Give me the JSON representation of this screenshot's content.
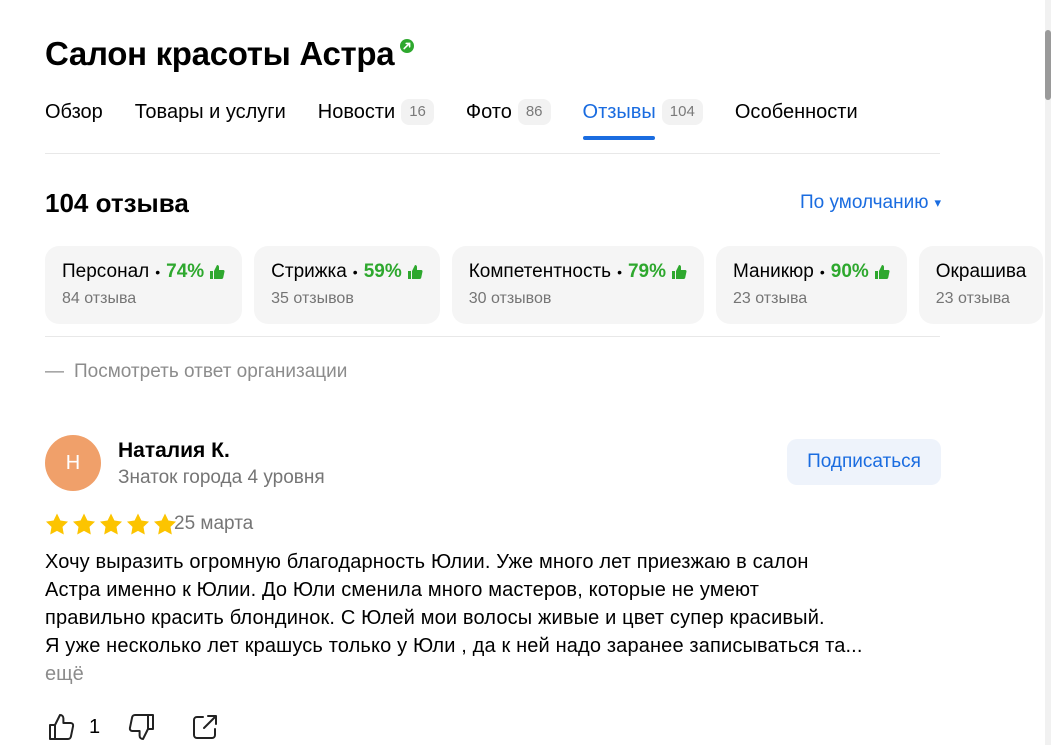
{
  "header": {
    "title": "Салон красоты Астра"
  },
  "tabs": [
    {
      "label": "Обзор",
      "badge": ""
    },
    {
      "label": "Товары и услуги",
      "badge": ""
    },
    {
      "label": "Новости",
      "badge": "16"
    },
    {
      "label": "Фото",
      "badge": "86"
    },
    {
      "label": "Отзывы",
      "badge": "104",
      "active": true
    },
    {
      "label": "Особенности",
      "badge": ""
    }
  ],
  "reviews": {
    "count_label": "104 отзыва",
    "sort_label": "По умолчанию",
    "sort_arrow": "▾"
  },
  "aspects": [
    {
      "name": "Персонал",
      "percent": "74%",
      "count": "84 отзыва"
    },
    {
      "name": "Стрижка",
      "percent": "59%",
      "count": "35 отзывов"
    },
    {
      "name": "Компетентность",
      "percent": "79%",
      "count": "30 отзывов"
    },
    {
      "name": "Маникюр",
      "percent": "90%",
      "count": "23 отзыва"
    },
    {
      "name": "Окрашива",
      "percent": "",
      "count": "23 отзыва"
    }
  ],
  "aspect_dot": "•",
  "org_reply": {
    "dash": "—",
    "label": "Посмотреть ответ организации"
  },
  "review": {
    "avatar_letter": "Н",
    "author": "Наталия К.",
    "level": "Знаток города 4 уровня",
    "subscribe_label": "Подписаться",
    "rating": 5,
    "date": "25 марта",
    "text_lines": [
      "Хочу выразить огромную благодарность Юлии. Уже много лет приезжаю в салон",
      "Астра именно к Юлии. До Юли сменила много мастеров, которые не умеют",
      "правильно красить блондинок. С Юлей мои волосы живые и цвет супер красивый.",
      "Я уже несколько лет крашусь только у Юли , да к ней надо заранее записываться та..."
    ],
    "more_label": "ещё",
    "likes": "1"
  },
  "colors": {
    "accent": "#1a6ce0",
    "positive": "#2ea82e",
    "star": "#fcc400",
    "avatar": "#f0a06a",
    "verified": "#2ea82e"
  }
}
